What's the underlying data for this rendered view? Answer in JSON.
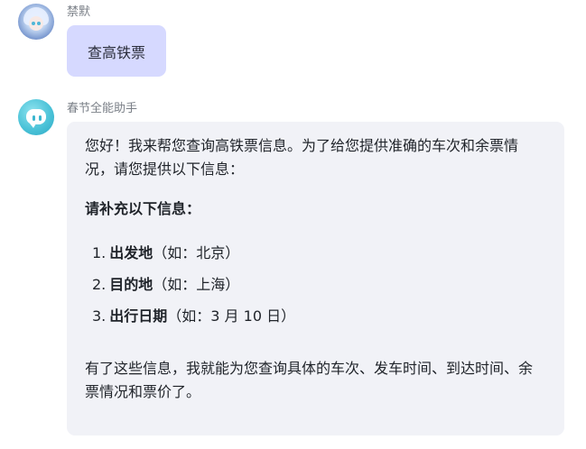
{
  "chat": {
    "user": {
      "name": "禁默",
      "message": "查高铁票"
    },
    "bot": {
      "name": "春节全能助手",
      "intro": "您好！我来帮您查询高铁票信息。为了给您提供准确的车次和余票情况，请您提供以下信息：",
      "heading": "请补充以下信息：",
      "items": [
        {
          "num": "1.",
          "label": "出发地",
          "example": "（如：北京）"
        },
        {
          "num": "2.",
          "label": "目的地",
          "example": "（如：上海）"
        },
        {
          "num": "3.",
          "label": "出行日期",
          "example": "（如：3 月 10 日）"
        }
      ],
      "outro": "有了这些信息，我就能为您查询具体的车次、发车时间、到达时间、余票情况和票价了。"
    }
  },
  "colors": {
    "user_bubble": "#d6d9ff",
    "bot_bubble": "#f1f2f7",
    "name_text": "#7a7f87",
    "bot_avatar": "#4cc3d8"
  },
  "icons": {
    "user_avatar": "anime-character-avatar",
    "bot_avatar": "chat-bubble-bot-avatar"
  }
}
